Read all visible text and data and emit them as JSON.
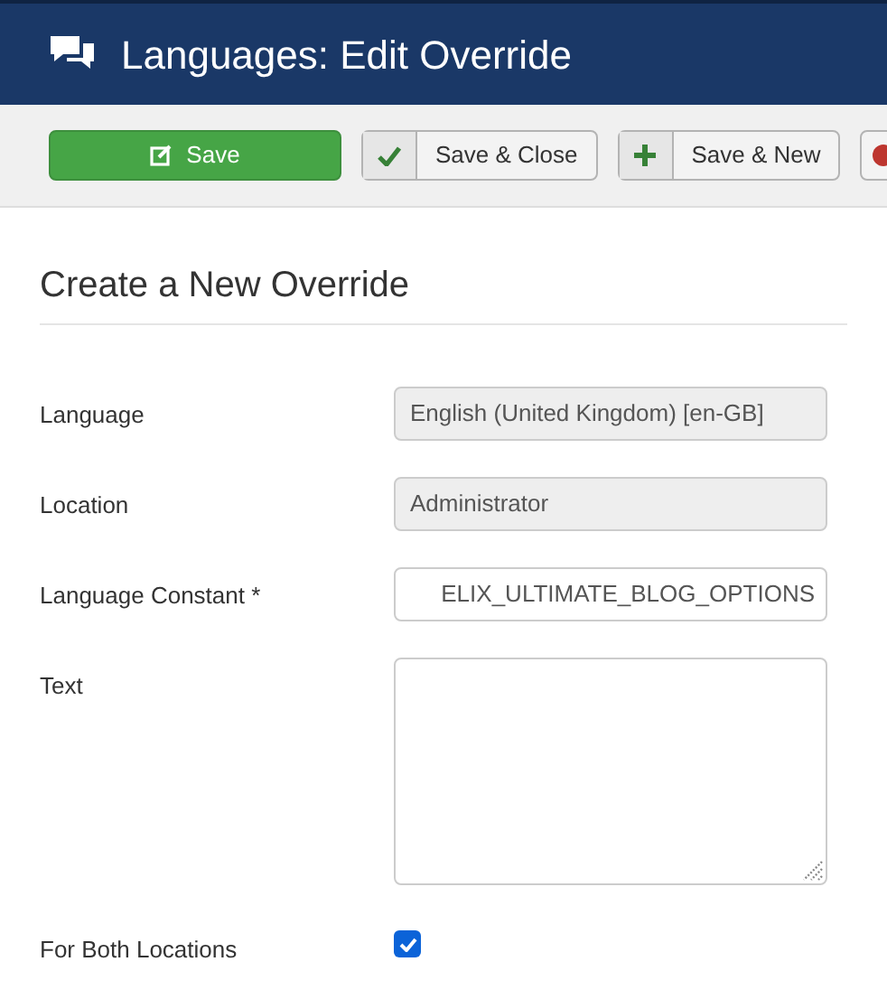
{
  "header": {
    "title": "Languages: Edit Override"
  },
  "toolbar": [
    {
      "kind": "primary",
      "label": "Save"
    },
    {
      "kind": "check",
      "label": "Save & Close"
    },
    {
      "kind": "plus",
      "label": "Save & New"
    },
    {
      "kind": "cut"
    }
  ],
  "form": {
    "heading": "Create a New Override",
    "fields": [
      {
        "kind": "readonly",
        "label": "Language",
        "value": "English (United Kingdom) [en-GB]"
      },
      {
        "kind": "readonly",
        "label": "Location",
        "value": "Administrator"
      },
      {
        "kind": "text",
        "label": "Language Constant *",
        "value": "ELIX_ULTIMATE_BLOG_OPTIONS"
      },
      {
        "kind": "textarea",
        "label": "Text"
      },
      {
        "kind": "checkbox",
        "label": "For Both Locations",
        "checked": true
      }
    ]
  }
}
